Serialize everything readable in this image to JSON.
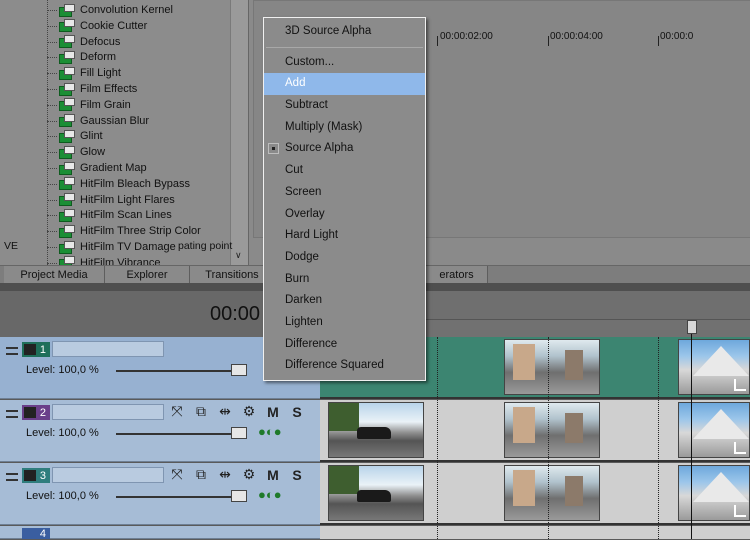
{
  "effects_list": {
    "items": [
      "Convolution Kernel",
      "Cookie Cutter",
      "Defocus",
      "Deform",
      "Fill Light",
      "Film Effects",
      "Film Grain",
      "Gaussian Blur",
      "Glint",
      "Glow",
      "Gradient Map",
      "HitFilm Bleach Bypass",
      "HitFilm Light Flares",
      "HitFilm Scan Lines",
      "HitFilm Three Strip Color",
      "HitFilm TV Damage",
      "HitFilm Vibrance"
    ],
    "scroll_arrow": "∨"
  },
  "description": {
    "left": "VE",
    "right": "pating point"
  },
  "tabs": {
    "project_media": "Project Media",
    "explorer": "Explorer",
    "transitions": "Transitions",
    "generators": "erators"
  },
  "timecode": "00:00",
  "ruler": {
    "labels": [
      "00:00:02:00",
      "00:00:04:00",
      "00:00:0"
    ]
  },
  "tracks": [
    {
      "number": "1",
      "level": "Level: 100,0 %"
    },
    {
      "number": "2",
      "level": "Level: 100,0 %",
      "mute": "M",
      "solo": "S"
    },
    {
      "number": "3",
      "level": "Level: 100,0 %",
      "mute": "M",
      "solo": "S"
    },
    {
      "number": "4"
    }
  ],
  "menu": {
    "items": [
      {
        "label": "3D Source Alpha"
      },
      {
        "separator": true
      },
      {
        "label": "Custom..."
      },
      {
        "label": "Add",
        "highlighted": true
      },
      {
        "label": "Subtract"
      },
      {
        "label": "Multiply (Mask)"
      },
      {
        "label": "Source Alpha",
        "checked": true
      },
      {
        "label": "Cut"
      },
      {
        "label": "Screen"
      },
      {
        "label": "Overlay"
      },
      {
        "label": "Hard Light"
      },
      {
        "label": "Dodge"
      },
      {
        "label": "Burn"
      },
      {
        "label": "Darken"
      },
      {
        "label": "Lighten"
      },
      {
        "label": "Difference"
      },
      {
        "label": "Difference Squared"
      }
    ]
  },
  "colors": {
    "menu_highlight": "#8fb8ea",
    "track_header": "#a6bcd6",
    "track_lane_selected": "#3c8571",
    "fx_plugin_green": "#1b8e35"
  }
}
